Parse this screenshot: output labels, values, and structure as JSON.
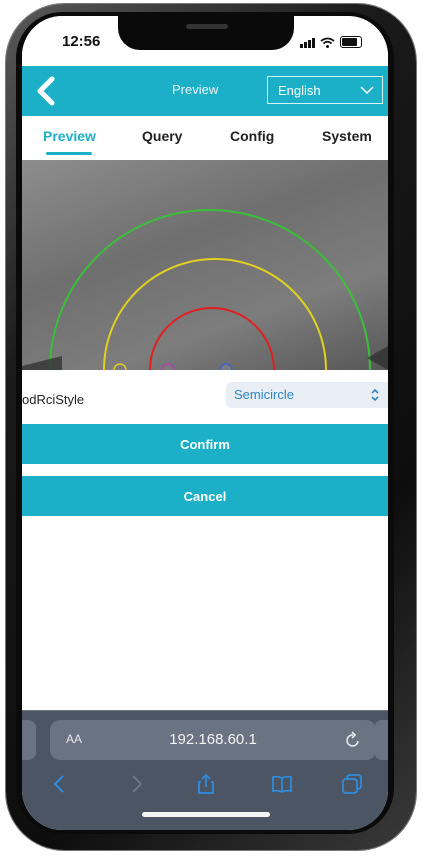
{
  "status_bar": {
    "time": "12:56"
  },
  "top_bar": {
    "title": "Preview",
    "language": "English"
  },
  "tabs": [
    {
      "label": "Preview",
      "active": true
    },
    {
      "label": "Query",
      "active": false
    },
    {
      "label": "Config",
      "active": false
    },
    {
      "label": "System",
      "active": false
    }
  ],
  "form": {
    "field_label": "odRciStyle",
    "field_value": "Semicircle"
  },
  "actions": {
    "confirm_label": "Confirm",
    "cancel_label": "Cancel"
  },
  "browser": {
    "aa_label": "AA",
    "url": "192.168.60.1"
  },
  "colors": {
    "accent": "#1cb0c8",
    "ring_outer": "#3bbf3b",
    "ring_middle": "#e0d020",
    "ring_inner": "#e02020",
    "safari_bar": "#4c5563",
    "toolbar_icon": "#2f8de0"
  },
  "icons": {
    "back": "chevron-left-icon",
    "language_dropdown": "chevron-down-icon",
    "select_stepper": "up-down-icon",
    "reload": "reload-icon",
    "nav_back": "chevron-left-icon",
    "nav_forward": "chevron-right-icon",
    "share": "share-icon",
    "bookmarks": "book-icon",
    "tabs": "tabs-icon"
  }
}
